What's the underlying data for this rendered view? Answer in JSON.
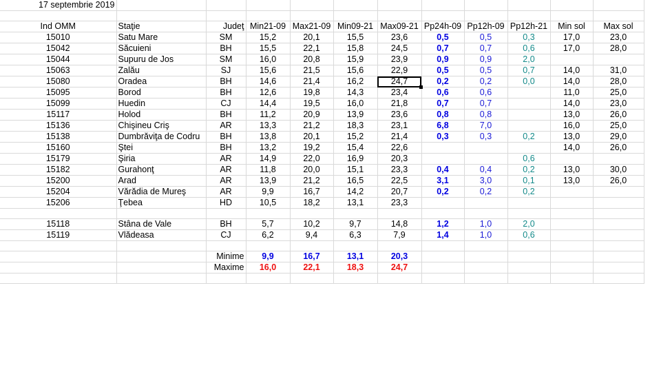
{
  "date": "17 septembrie 2019",
  "headers": [
    "Ind OMM",
    "Staţie",
    "Judeţ",
    "Min21-09",
    "Max21-09",
    "Min09-21",
    "Max09-21",
    "Pp24h-09",
    "Pp12h-09",
    "Pp12h-21",
    "Min sol",
    "Max sol"
  ],
  "rows": [
    [
      "15010",
      "Satu Mare",
      "SM",
      "15,2",
      "20,1",
      "15,5",
      "23,6",
      "0,5",
      "0,5",
      "0,3",
      "17,0",
      "23,0"
    ],
    [
      "15042",
      "Săcuieni",
      "BH",
      "15,5",
      "22,1",
      "15,8",
      "24,5",
      "0,7",
      "0,7",
      "0,6",
      "17,0",
      "28,0"
    ],
    [
      "15044",
      "Supuru de Jos",
      "SM",
      "16,0",
      "20,8",
      "15,9",
      "23,9",
      "0,9",
      "0,9",
      "2,0",
      "",
      ""
    ],
    [
      "15063",
      "Zalău",
      "SJ",
      "15,6",
      "21,5",
      "15,6",
      "22,9",
      "0,5",
      "0,5",
      "0,7",
      "14,0",
      "31,0"
    ],
    [
      "15080",
      "Oradea",
      "BH",
      "14,6",
      "21,4",
      "16,2",
      "24,7",
      "0,2",
      "0,2",
      "0,0",
      "14,0",
      "28,0"
    ],
    [
      "15095",
      "Borod",
      "BH",
      "12,6",
      "19,8",
      "14,3",
      "23,4",
      "0,6",
      "0,6",
      "",
      "11,0",
      "25,0"
    ],
    [
      "15099",
      "Huedin",
      "CJ",
      "14,4",
      "19,5",
      "16,0",
      "21,8",
      "0,7",
      "0,7",
      "",
      "14,0",
      "23,0"
    ],
    [
      "15117",
      "Holod",
      "BH",
      "11,2",
      "20,9",
      "13,9",
      "23,6",
      "0,8",
      "0,8",
      "",
      "13,0",
      "26,0"
    ],
    [
      "15136",
      "Chişineu    Criş",
      "AR",
      "13,3",
      "21,2",
      "18,3",
      "23,1",
      "6,8",
      "7,0",
      "",
      "16,0",
      "25,0"
    ],
    [
      "15138",
      "Dumbrăviţa  de Codru",
      "BH",
      "13,8",
      "20,1",
      "15,2",
      "21,4",
      "0,3",
      "0,3",
      "0,2",
      "13,0",
      "29,0"
    ],
    [
      "15160",
      "Ştei",
      "BH",
      "13,2",
      "19,2",
      "15,4",
      "22,6",
      "",
      "",
      "",
      "14,0",
      "26,0"
    ],
    [
      "15179",
      "Şiria",
      "AR",
      "14,9",
      "22,0",
      "16,9",
      "20,3",
      "",
      "",
      "0,6",
      "",
      ""
    ],
    [
      "15182",
      "Gurahonţ",
      "AR",
      "11,8",
      "20,0",
      "15,1",
      "23,3",
      "0,4",
      "0,4",
      "0,2",
      "13,0",
      "30,0"
    ],
    [
      "15200",
      "Arad",
      "AR",
      "13,9",
      "21,2",
      "16,5",
      "22,5",
      "3,1",
      "3,0",
      "0,1",
      "13,0",
      "26,0"
    ],
    [
      "15204",
      "Vărădia de Mureş",
      "AR",
      "9,9",
      "16,7",
      "14,2",
      "20,7",
      "0,2",
      "0,2",
      "0,2",
      "",
      ""
    ],
    [
      "15206",
      "Ţebea",
      "HD",
      "10,5",
      "18,2",
      "13,1",
      "23,3",
      "",
      "",
      "",
      "",
      ""
    ]
  ],
  "mountain_rows": [
    [
      "15118",
      "Stâna de Vale",
      "BH",
      "5,7",
      "10,2",
      "9,7",
      "14,8",
      "1,2",
      "1,0",
      "2,0",
      "",
      ""
    ],
    [
      "15119",
      "Vlădeasa",
      "CJ",
      "6,2",
      "9,4",
      "6,3",
      "7,9",
      "1,4",
      "1,0",
      "0,6",
      "",
      ""
    ]
  ],
  "summary": {
    "min_label": "Minime",
    "max_label": "Maxime",
    "minimums": [
      "9,9",
      "16,7",
      "13,1",
      "20,3"
    ],
    "maximums": [
      "16,0",
      "22,1",
      "18,3",
      "24,7"
    ]
  }
}
